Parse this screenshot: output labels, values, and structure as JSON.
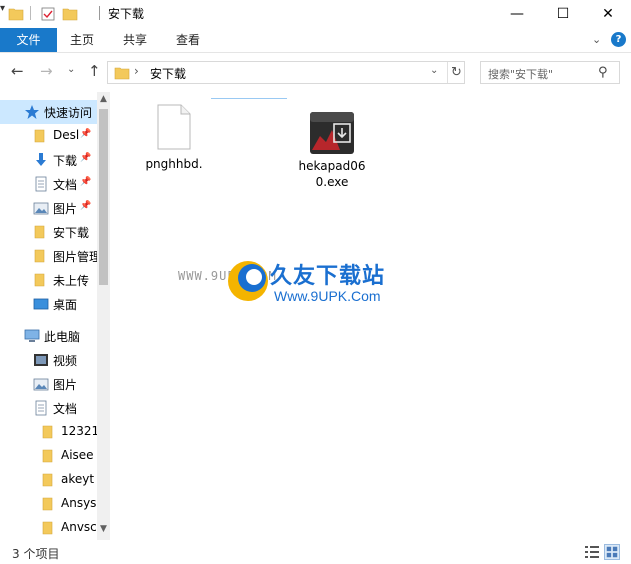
{
  "window": {
    "title": "安下载",
    "minimize": "—",
    "maximize": "☐",
    "close": "✕"
  },
  "ribbon": {
    "tabs": [
      "文件",
      "主页",
      "共享",
      "查看"
    ]
  },
  "address": {
    "path": "安下载",
    "search_placeholder": "搜索\"安下载\""
  },
  "nav_pane": {
    "items": [
      {
        "label": "快速访问",
        "icon": "star-icon",
        "pinned": false
      },
      {
        "label": "Desl",
        "icon": "folder-icon",
        "pinned": true
      },
      {
        "label": "下载",
        "icon": "download-icon",
        "pinned": true
      },
      {
        "label": "文档",
        "icon": "document-icon",
        "pinned": true
      },
      {
        "label": "图片",
        "icon": "picture-icon",
        "pinned": true
      },
      {
        "label": "安下载",
        "icon": "folder-icon",
        "pinned": false
      },
      {
        "label": "图片管理",
        "icon": "folder-icon",
        "pinned": false
      },
      {
        "label": "未上传",
        "icon": "folder-icon",
        "pinned": false
      },
      {
        "label": "桌面",
        "icon": "desktop-icon",
        "pinned": false
      },
      {
        "label": "此电脑",
        "icon": "computer-icon",
        "pinned": false
      },
      {
        "label": "视频",
        "icon": "video-icon",
        "pinned": false
      },
      {
        "label": "图片",
        "icon": "picture-icon",
        "pinned": false
      },
      {
        "label": "文档",
        "icon": "document-icon",
        "pinned": false
      },
      {
        "label": "12321",
        "icon": "folder-icon",
        "pinned": false
      },
      {
        "label": "Aisee",
        "icon": "folder-icon",
        "pinned": false
      },
      {
        "label": "akeyt",
        "icon": "folder-icon",
        "pinned": false
      },
      {
        "label": "Ansys",
        "icon": "folder-icon",
        "pinned": false
      },
      {
        "label": "Anvsc",
        "icon": "folder-icon",
        "pinned": false
      }
    ]
  },
  "files": [
    {
      "name": "pnghhbd.",
      "icon": "blank-file-icon"
    },
    {
      "name": "hekapad060.exe",
      "icon": "exe-icon"
    }
  ],
  "watermark": {
    "small_url": "WWW.9UPK.COM",
    "title": "久友下载站",
    "url": "Www.9UPK.Com"
  },
  "status": {
    "count": "3 个项目"
  }
}
